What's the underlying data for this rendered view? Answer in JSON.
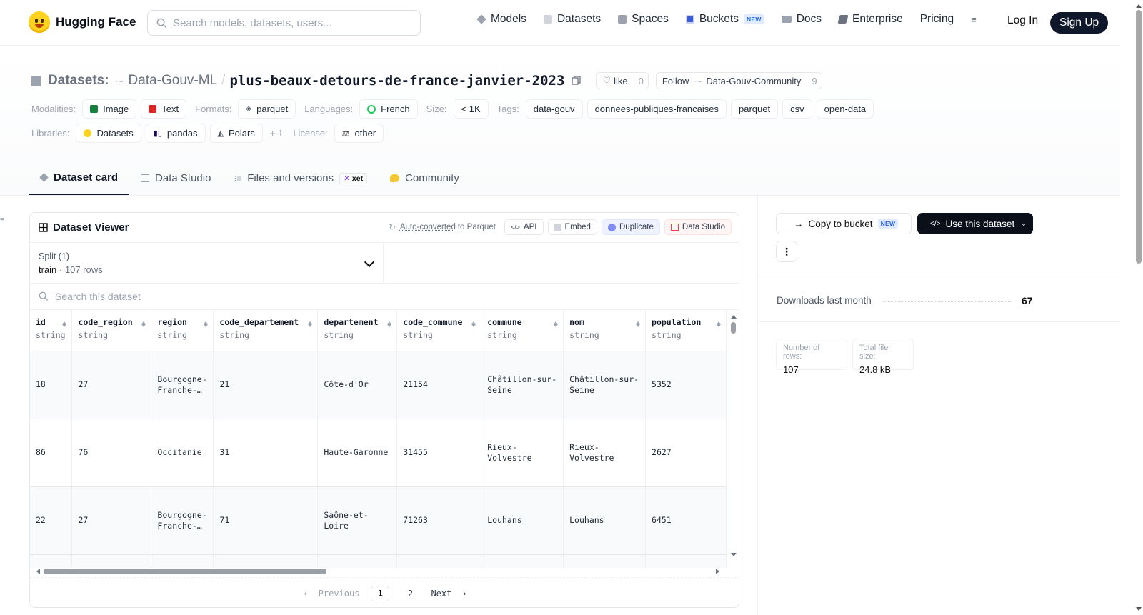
{
  "nav": {
    "brand": "Hugging Face",
    "search_placeholder": "Search models, datasets, users...",
    "links": [
      {
        "label": "Models",
        "icon": "models-icon",
        "color": "#9ca3af"
      },
      {
        "label": "Datasets",
        "icon": "datasets-icon",
        "color": "#d1d5db"
      },
      {
        "label": "Spaces",
        "icon": "spaces-icon",
        "color": "#9ca3af"
      },
      {
        "label": "Buckets",
        "icon": "buckets-icon",
        "color": "#3b5bdb",
        "badge": "NEW"
      },
      {
        "label": "Docs",
        "icon": "docs-icon",
        "color": "#9ca3af"
      },
      {
        "label": "Enterprise",
        "icon": "enterprise-icon",
        "color": "#6b7280"
      },
      {
        "label": "Pricing"
      }
    ],
    "more_icon": "≡",
    "login": "Log In",
    "signup": "Sign Up"
  },
  "repo": {
    "prefix": "Datasets:",
    "org": "Data-Gouv-ML",
    "name": "plus-beaux-detours-de-france-janvier-2023",
    "like_label": "like",
    "like_count": "0",
    "follow_label": "Follow",
    "follow_org": "Data-Gouv-Community",
    "follow_count": "9"
  },
  "meta": {
    "modalities_label": "Modalities:",
    "modalities": [
      {
        "label": "Image",
        "color": "#15803d"
      },
      {
        "label": "Text",
        "color": "#dc2626"
      }
    ],
    "formats_label": "Formats:",
    "formats": [
      "parquet"
    ],
    "languages_label": "Languages:",
    "languages": [
      "French"
    ],
    "size_label": "Size:",
    "size": "< 1K",
    "tags_label": "Tags:",
    "tags": [
      "data-gouv",
      "donnees-publiques-francaises",
      "parquet",
      "csv",
      "open-data"
    ],
    "libraries_label": "Libraries:",
    "libraries": [
      "Datasets",
      "pandas",
      "Polars"
    ],
    "libraries_more": "+ 1",
    "license_label": "License:",
    "license": "other"
  },
  "tabs": [
    {
      "label": "Dataset card",
      "active": true
    },
    {
      "label": "Data Studio"
    },
    {
      "label": "Files and versions",
      "badge": "xet"
    },
    {
      "label": "Community"
    }
  ],
  "viewer": {
    "title": "Dataset Viewer",
    "auto_converted": "Auto-converted",
    "to_parquet": "to Parquet",
    "actions": [
      "API",
      "Embed",
      "Duplicate",
      "Data Studio"
    ],
    "split_label": "Split (1)",
    "split_name": "train",
    "split_rows": "107 rows",
    "search_placeholder": "Search this dataset",
    "columns": [
      {
        "name": "id",
        "type": "string"
      },
      {
        "name": "code_region",
        "type": "string"
      },
      {
        "name": "region",
        "type": "string"
      },
      {
        "name": "code_departement",
        "type": "string"
      },
      {
        "name": "departement",
        "type": "string"
      },
      {
        "name": "code_commune",
        "type": "string"
      },
      {
        "name": "commune",
        "type": "string"
      },
      {
        "name": "nom",
        "type": "string"
      },
      {
        "name": "population",
        "type": "string"
      }
    ],
    "rows": [
      [
        "18",
        "27",
        "Bourgogne-Franche-…",
        "21",
        "Côte-d'Or",
        "21154",
        "Châtillon-sur-Seine",
        "Châtillon-sur-Seine",
        "5352"
      ],
      [
        "86",
        "76",
        "Occitanie",
        "31",
        "Haute-Garonne",
        "31455",
        "Rieux-Volvestre",
        "Rieux-Volvestre",
        "2627"
      ],
      [
        "22",
        "27",
        "Bourgogne-Franche-…",
        "71",
        "Saône-et-Loire",
        "71263",
        "Louhans",
        "Louhans",
        "6451"
      ]
    ],
    "pager": {
      "previous": "Previous",
      "pages": [
        "1",
        "2"
      ],
      "current": "1",
      "next": "Next"
    }
  },
  "sidebar": {
    "copy_to_bucket": "Copy to bucket",
    "copy_badge": "NEW",
    "use_dataset": "Use this dataset",
    "downloads_label": "Downloads last month",
    "downloads_value": "67",
    "rows_label": "Number of rows:",
    "rows_value": "107",
    "size_label": "Total file size:",
    "size_value": "24.8 kB"
  }
}
